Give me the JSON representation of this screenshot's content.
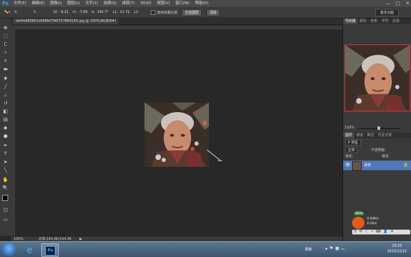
{
  "app": {
    "logo": "Ps"
  },
  "menu": [
    "文件(F)",
    "编辑(E)",
    "图像(I)",
    "图层(L)",
    "文字(Y)",
    "选择(S)",
    "滤镜(T)",
    "3D(D)",
    "视图(V)",
    "窗口(W)",
    "帮助(H)"
  ],
  "window_controls": [
    "—",
    "□",
    "✕"
  ],
  "options": {
    "x_label": "X:",
    "x_value": "",
    "y_label": "Y:",
    "y_value": "",
    "w_label": "W:",
    "w_value": "-9.21",
    "h_label": "H:",
    "h_value": "-7.09",
    "a_label": "A:",
    "a_value": "142.7°",
    "l1_label": "L1:",
    "l1_value": "11.71",
    "l2_label": "L2:",
    "l2_value": "",
    "use_measure_scale": "使用测量比例",
    "straighten_button": "拉直图层",
    "clear_button": "清除",
    "workspace": "基本功能"
  },
  "document": {
    "tab_label": "de0fe880861e688bf796f757869180.jpg @ 100%(RGB/8#)"
  },
  "status": {
    "zoom": "100%",
    "doc_info": "文档:144.4K/144.4K"
  },
  "navigator": {
    "tabs": [
      "导航器",
      "颜色",
      "色板",
      "字符",
      "段落"
    ],
    "zoom": "100%"
  },
  "layers": {
    "tabs": [
      "图层",
      "通道",
      "路径",
      "历史记录"
    ],
    "kind_label": "P 类型",
    "blend_mode": "正常",
    "opacity_label": "不透明度:",
    "lock_label": "锁定:",
    "fill_label": "填充:",
    "layer_name": "背景",
    "lock_icon": "🔒"
  },
  "ime": {
    "percent": "68%",
    "speed_label": "0.04K/s",
    "speed_label2": "0.1K/s"
  },
  "taskbar": {
    "desktop_label": "桌面",
    "time": "10:25",
    "date": "2015/12/11"
  }
}
